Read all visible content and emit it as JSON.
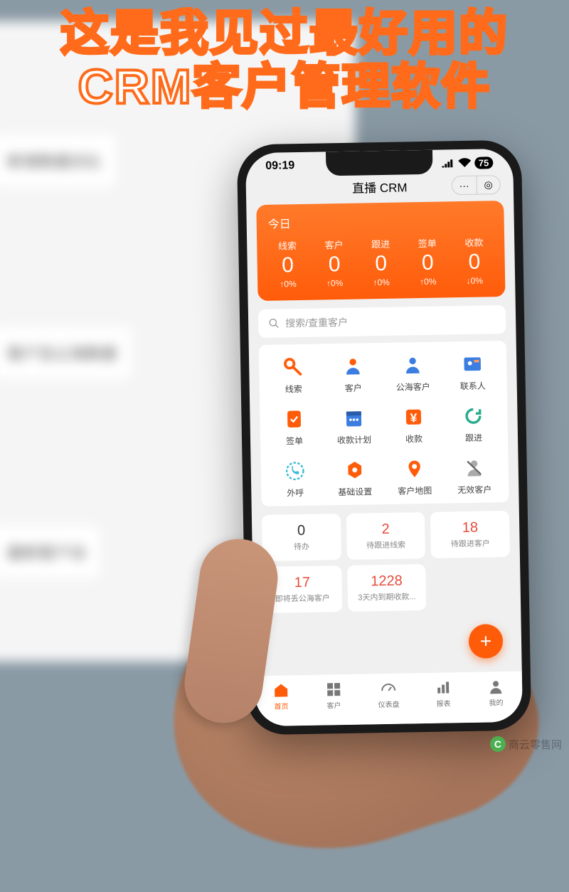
{
  "headline": {
    "line1": "这是我见过最好用的",
    "line2": "CRM客户管理软件"
  },
  "status": {
    "time": "09:19",
    "battery": "75"
  },
  "mini": {
    "title": "直播 CRM",
    "more": "···",
    "close": "◎"
  },
  "today": {
    "label": "今日",
    "stats": [
      {
        "label": "线索",
        "value": "0",
        "trend": "↑0%"
      },
      {
        "label": "客户",
        "value": "0",
        "trend": "↑0%"
      },
      {
        "label": "跟进",
        "value": "0",
        "trend": "↑0%"
      },
      {
        "label": "签单",
        "value": "0",
        "trend": "↑0%"
      },
      {
        "label": "收款",
        "value": "0",
        "trend": "↓0%"
      }
    ]
  },
  "search": {
    "placeholder": "搜索/查重客户"
  },
  "nav": [
    {
      "label": "线索",
      "color": "#ff5c0a"
    },
    {
      "label": "客户",
      "color": "#3b7de0"
    },
    {
      "label": "公海客户",
      "color": "#3b7de0"
    },
    {
      "label": "联系人",
      "color": "#3b7de0"
    },
    {
      "label": "签单",
      "color": "#ff5c0a"
    },
    {
      "label": "收款计划",
      "color": "#3b7de0"
    },
    {
      "label": "收款",
      "color": "#ff5c0a"
    },
    {
      "label": "跟进",
      "color": "#2bab8e"
    },
    {
      "label": "外呼",
      "color": "#3bbad6"
    },
    {
      "label": "基础设置",
      "color": "#ff5c0a"
    },
    {
      "label": "客户地图",
      "color": "#ff5c0a"
    },
    {
      "label": "无效客户",
      "color": "#888"
    }
  ],
  "kpi": [
    {
      "value": "0",
      "label": "待办",
      "red": false
    },
    {
      "value": "2",
      "label": "待跟进线索",
      "red": true
    },
    {
      "value": "18",
      "label": "待跟进客户",
      "red": true
    },
    {
      "value": "17",
      "label": "即将丢公海客户",
      "red": true
    },
    {
      "value": "1228",
      "label": "3天内到期收款...",
      "red": true
    }
  ],
  "fab": "+",
  "bottomNav": [
    {
      "label": "首页",
      "active": true
    },
    {
      "label": "客户",
      "active": false
    },
    {
      "label": "仪表盘",
      "active": false
    },
    {
      "label": "报表",
      "active": false
    },
    {
      "label": "我的",
      "active": false
    }
  ],
  "bg": {
    "section1": "新增数据对比",
    "section2": "客户及公海数据",
    "section3": "最新客户动"
  },
  "watermark": "商云零售网"
}
